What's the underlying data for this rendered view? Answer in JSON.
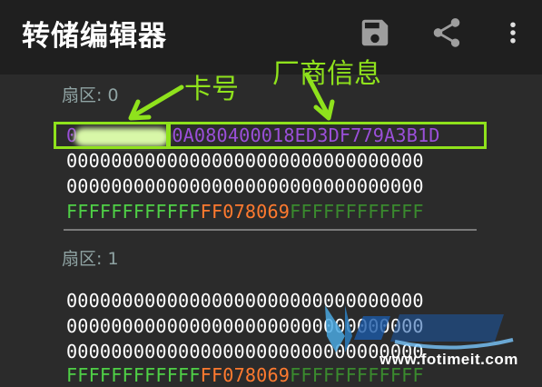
{
  "appbar": {
    "title": "转储编辑器",
    "save_icon": "save-icon",
    "share_icon": "share-icon",
    "menu_icon": "overflow-menu-icon"
  },
  "sector0": {
    "label": "扇区: 0",
    "line0_visible_prefix": "0",
    "line0_purple": "0A080400018ED3DF779A3B1D",
    "line1": "00000000000000000000000000000000",
    "line2": "00000000000000000000000000000000",
    "line3_green": "FFFFFFFFFFFF",
    "line3_orange": "FF078069",
    "line3_dkgreen": "FFFFFFFFFFFF"
  },
  "sector1": {
    "label": "扇区: 1",
    "line1": "00000000000000000000000000000000",
    "line2": "00000000000000000000000000000000",
    "line3": "00000000000000000000000000000000",
    "line4_green": "FFFFFFFFFFFF",
    "line4_orange": "FF078069",
    "line4_dkgreen": "FFFFFFFFFFFF"
  },
  "annotations": {
    "card_number": "卡号",
    "vendor_info": "厂商信息",
    "color": "#8fe21c"
  },
  "watermark": {
    "url": "www.fotimeit.com"
  }
}
